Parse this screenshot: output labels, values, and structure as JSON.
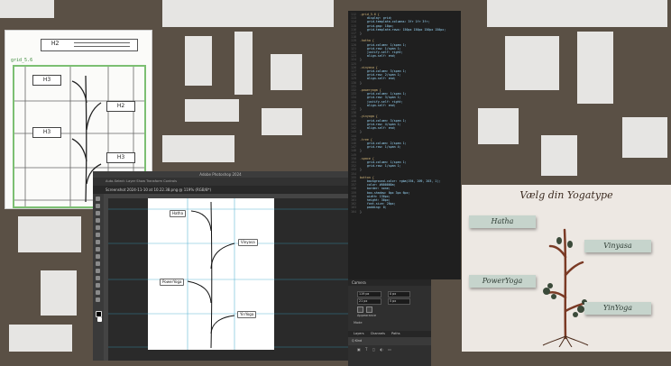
{
  "sketch": {
    "header": "H2",
    "grid_label": "grid_5.6",
    "boxes": [
      "H3",
      "H2",
      "H3",
      "H3"
    ]
  },
  "photoshop": {
    "title": "Adobe Photoshop 2024",
    "options": "Auto-Select:  Layer   Show Transform Controls",
    "tab": "Screenshot 2024-11-10 at 10.22.38.png @ 119% (RGB/8*)",
    "labels": {
      "hatha": "Hatha",
      "vinyasa": "Vinyasa",
      "poweryoga": "PowerYoga",
      "yinyoga": "YinYoga"
    }
  },
  "code": {
    "lines": [
      {
        "n": "112",
        "t": ".grid_5.6 {"
      },
      {
        "n": "113",
        "t": "    display: grid;"
      },
      {
        "n": "114",
        "t": "    grid-template-columns: 3fr 1fr 3fr;"
      },
      {
        "n": "115",
        "t": "    grid-gap: 10px;"
      },
      {
        "n": "116",
        "t": "    grid-template-rows: 150px 150px 150px 150px;"
      },
      {
        "n": "117",
        "t": "}"
      },
      {
        "n": "118",
        "t": ""
      },
      {
        "n": "119",
        "t": ".hatha {"
      },
      {
        "n": "120",
        "t": "    grid-column: 1/span 1;"
      },
      {
        "n": "121",
        "t": "    grid-row: 1/span 1;"
      },
      {
        "n": "122",
        "t": "    justify-self: right;"
      },
      {
        "n": "123",
        "t": "    align-self: end;"
      },
      {
        "n": "124",
        "t": "}"
      },
      {
        "n": "125",
        "t": ""
      },
      {
        "n": "126",
        "t": ".vinyasa {"
      },
      {
        "n": "127",
        "t": "    grid-column: 3/span 1;"
      },
      {
        "n": "128",
        "t": "    grid-row: 2/span 1;"
      },
      {
        "n": "129",
        "t": "    align-self: end;"
      },
      {
        "n": "130",
        "t": "}"
      },
      {
        "n": "131",
        "t": ""
      },
      {
        "n": "132",
        "t": ".poweryoga {"
      },
      {
        "n": "133",
        "t": "    grid-column: 1/span 1;"
      },
      {
        "n": "134",
        "t": "    grid-row: 3/span 1;"
      },
      {
        "n": "135",
        "t": "    justify-self: right;"
      },
      {
        "n": "136",
        "t": "    align-self: end;"
      },
      {
        "n": "137",
        "t": "}"
      },
      {
        "n": "138",
        "t": ""
      },
      {
        "n": "139",
        "t": ".yinyoga {"
      },
      {
        "n": "140",
        "t": "    grid-column: 3/span 1;"
      },
      {
        "n": "141",
        "t": "    grid-row: 4/span 1;"
      },
      {
        "n": "142",
        "t": "    align-self: end;"
      },
      {
        "n": "143",
        "t": "}"
      },
      {
        "n": "144",
        "t": ""
      },
      {
        "n": "145",
        "t": ".tree {"
      },
      {
        "n": "146",
        "t": "    grid-column: 2/span 1;"
      },
      {
        "n": "147",
        "t": "    grid-row: 1/span 4;"
      },
      {
        "n": "148",
        "t": "}"
      },
      {
        "n": "149",
        "t": ""
      },
      {
        "n": "150",
        "t": ".space {"
      },
      {
        "n": "151",
        "t": "    grid-column: 1/span 1;"
      },
      {
        "n": "152",
        "t": "    grid-row: 1/span 1;"
      },
      {
        "n": "153",
        "t": "}"
      },
      {
        "n": "154",
        "t": ""
      },
      {
        "n": "155",
        "t": "button {"
      },
      {
        "n": "156",
        "t": "    background-color: rgba(194, 209, 203, 1);"
      },
      {
        "n": "157",
        "t": "    color: #000000a;"
      },
      {
        "n": "158",
        "t": "    border: none;"
      },
      {
        "n": "159",
        "t": "    box-shadow: 0px 3px 6px;"
      },
      {
        "n": "160",
        "t": "    width: 130px;"
      },
      {
        "n": "161",
        "t": "    height: 30px;"
      },
      {
        "n": "162",
        "t": "    font-size: 20px;"
      },
      {
        "n": "163",
        "t": "    padding: 0;"
      },
      {
        "n": "164",
        "t": "}"
      }
    ]
  },
  "properties": {
    "header": "Camera",
    "w_value": "119 px",
    "h_value": "21 px",
    "x_value": "0 px",
    "y_value": "5 px",
    "appearance": "Appearance",
    "mode": "Mode",
    "tabs": [
      "Layers",
      "Channels",
      "Paths"
    ],
    "layer_name": "Q Kind"
  },
  "yoga": {
    "title": "Vælg din Yogatype",
    "buttons": {
      "hatha": "Hatha",
      "vinyasa": "Vinyasa",
      "poweryoga": "PowerYoga",
      "yinyoga": "YinYoga"
    },
    "button_color": "#c6d4cc",
    "background": "#ede8e3"
  }
}
